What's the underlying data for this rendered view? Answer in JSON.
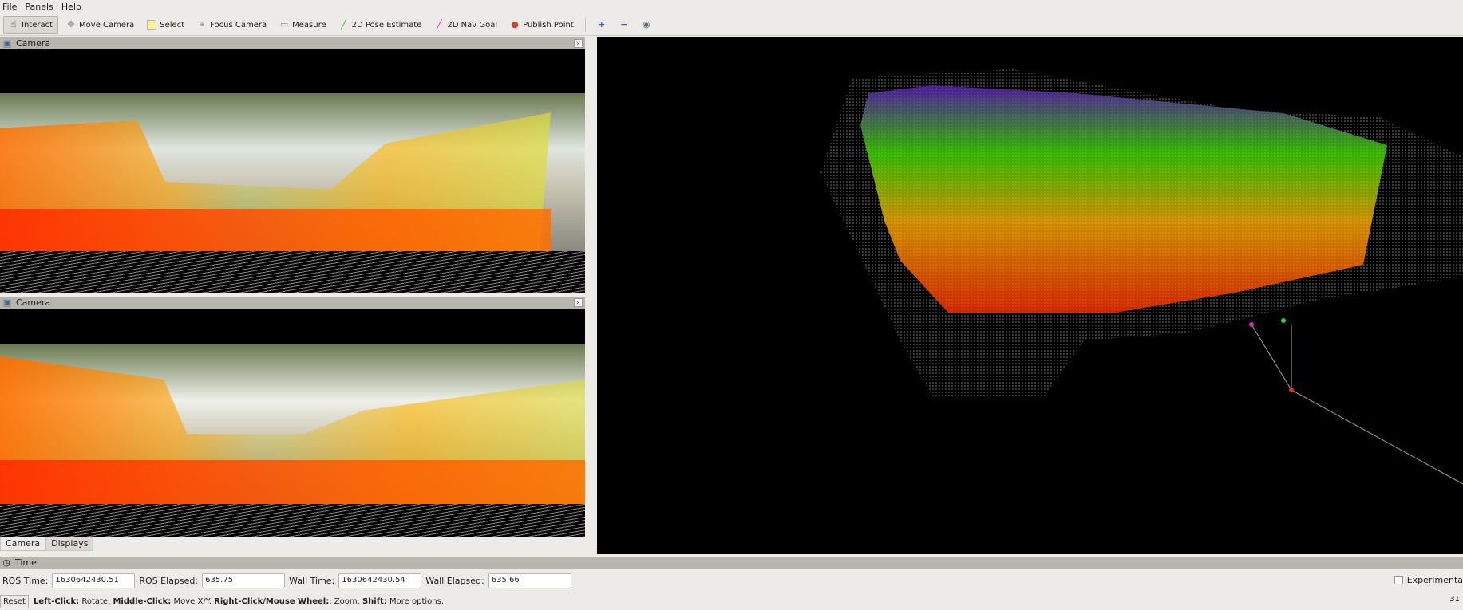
{
  "menu": [
    "File",
    "Panels",
    "Help"
  ],
  "toolbar": [
    {
      "label": "Interact",
      "icon": "hand-cursor-icon",
      "active": true
    },
    {
      "label": "Move Camera",
      "icon": "move-camera-icon"
    },
    {
      "label": "Select",
      "icon": "select-icon"
    },
    {
      "label": "Focus Camera",
      "icon": "focus-camera-icon"
    },
    {
      "label": "Measure",
      "icon": "ruler-icon"
    },
    {
      "label": "2D Pose Estimate",
      "icon": "green-arrow-icon"
    },
    {
      "label": "2D Nav Goal",
      "icon": "pink-arrow-icon"
    },
    {
      "label": "Publish Point",
      "icon": "map-pin-icon"
    }
  ],
  "panels": [
    {
      "title": "Camera"
    },
    {
      "title": "Camera"
    }
  ],
  "tabs": [
    "Camera",
    "Displays"
  ],
  "time": {
    "title": "Time",
    "ros_time_label": "ROS Time:",
    "ros_time": "1630642430.51",
    "ros_elapsed_label": "ROS Elapsed:",
    "ros_elapsed": "635.75",
    "wall_time_label": "Wall Time:",
    "wall_time": "1630642430.54",
    "wall_elapsed_label": "Wall Elapsed:",
    "wall_elapsed": "635.66",
    "experimental": "Experimenta"
  },
  "status": {
    "reset": "Reset",
    "b1": "Left-Click:",
    "t1": "Rotate.",
    "b2": "Middle-Click:",
    "t2": "Move X/Y.",
    "b3": "Right-Click/Mouse Wheel:",
    "t3": ": Zoom.",
    "b4": "Shift:",
    "t4": "More options.",
    "fps": "31"
  },
  "colors": {
    "near": "#ff3000",
    "mid": "#ffb000",
    "far": "#40e000",
    "farther": "#6020c0"
  }
}
